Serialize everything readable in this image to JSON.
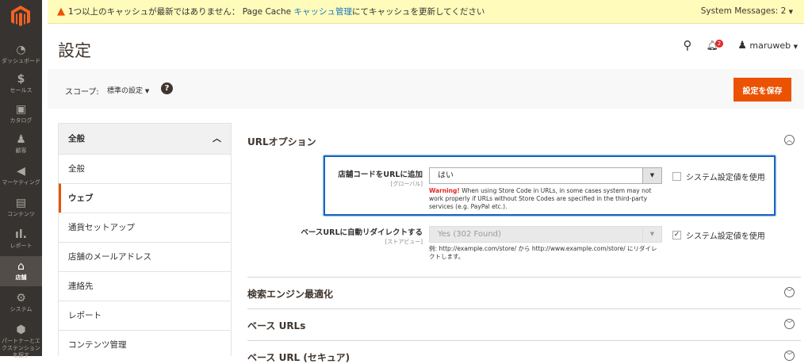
{
  "sidebar": {
    "items": [
      {
        "label": "ダッシュボード",
        "icon": "dashboard-icon"
      },
      {
        "label": "セールス",
        "icon": "dollar-icon"
      },
      {
        "label": "カタログ",
        "icon": "box-icon"
      },
      {
        "label": "顧客",
        "icon": "person-icon"
      },
      {
        "label": "マーケティング",
        "icon": "megaphone-icon"
      },
      {
        "label": "コンテンツ",
        "icon": "layout-icon"
      },
      {
        "label": "レポート",
        "icon": "bar-chart-icon"
      },
      {
        "label": "店舗",
        "icon": "store-icon",
        "active": true
      },
      {
        "label": "システム",
        "icon": "gear-icon"
      },
      {
        "label": "パートナーとエクステンションを探す",
        "icon": "cube-icon"
      }
    ]
  },
  "message": {
    "text1": "1つ以上のキャッシュが最新ではありません： Page Cache ",
    "link": "キャッシュ管理",
    "text2": "にてキャッシュを更新してください",
    "system_messages": "System Messages: 2"
  },
  "header": {
    "title": "設定",
    "notifications": "2",
    "user": "maruweb"
  },
  "scope": {
    "label": "スコープ:",
    "value": "標準の設定",
    "help": "?",
    "save": "設定を保存"
  },
  "left_nav": {
    "group": "全般",
    "items": [
      "全般",
      "ウェブ",
      "通貨セットアップ",
      "店舗のメールアドレス",
      "連絡先",
      "レポート",
      "コンテンツ管理"
    ],
    "active": "ウェブ"
  },
  "main": {
    "section1": "URLオプション",
    "field1": {
      "label": "店舗コードをURLに追加",
      "scope": "[グローバル]",
      "value": "はい",
      "warning_label": "Warning!",
      "warning": " When using Store Code in URLs, in some cases system may not work properly if URLs without Store Codes are specified in the third-party services (e.g. PayPal etc.).",
      "use_system": "システム設定値を使用",
      "use_system_checked": false
    },
    "field2": {
      "label": "ベースURLに自動リダイレクトする",
      "scope": "[ストアビュー]",
      "value": "Yes (302 Found)",
      "note": "例: http://example.com/store/ から http://www.example.com/store/ にリダイレクトします。",
      "use_system": "システム設定値を使用",
      "use_system_checked": true
    },
    "section2": "検索エンジン最適化",
    "section3": "ベース URLs",
    "section4": "ベース URL (セキュア)"
  }
}
